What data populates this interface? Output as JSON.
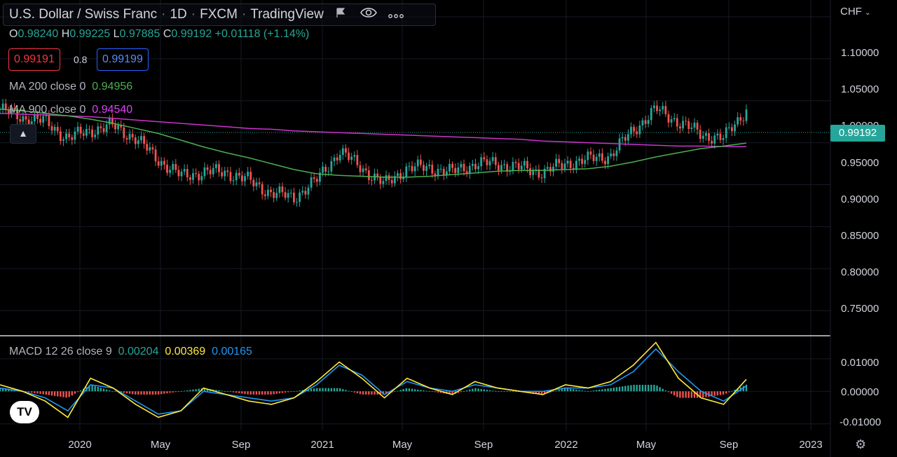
{
  "header": {
    "symbol": "U.S. Dollar / Swiss Franc",
    "interval": "1D",
    "exchange": "FXCM",
    "publisher": "TradingView",
    "separator": "·"
  },
  "ohlc": {
    "o_label": "O",
    "o": "0.98240",
    "h_label": "H",
    "h": "0.99225",
    "l_label": "L",
    "l": "0.97885",
    "c_label": "C",
    "c": "0.99192",
    "change": "+0.01118 (+1.14%)"
  },
  "trade": {
    "sell_price": "0.99191",
    "spread": "0.8",
    "buy_price": "0.99199"
  },
  "indicators": {
    "ma200_label": "MA 200 close 0",
    "ma200_value": "0.94956",
    "ma900_label": "MA 900 close 0",
    "ma900_value": "0.94540"
  },
  "macd": {
    "label": "MACD 12 26 close 9",
    "hist": "0.00204",
    "macd": "0.00369",
    "signal": "0.00165"
  },
  "price_axis": {
    "currency": "CHF",
    "ticks": [
      "1.10000",
      "1.05000",
      "1.00000",
      "0.95000",
      "0.90000",
      "0.85000",
      "0.80000",
      "0.75000"
    ],
    "last_price": "0.99192"
  },
  "macd_axis": {
    "ticks": [
      "0.01000",
      "0.00000",
      "-0.01000"
    ]
  },
  "time_axis": {
    "ticks": [
      "2020",
      "May",
      "Sep",
      "2021",
      "May",
      "Sep",
      "2022",
      "May",
      "Sep",
      "2023"
    ]
  },
  "colors": {
    "up": "#26a69a",
    "down": "#ef5350",
    "ma200": "#4caf50",
    "ma900": "#cc33cc",
    "macd_line": "#ffeb3b",
    "signal_line": "#2196f3"
  },
  "icons": {
    "flag": "flag-icon",
    "eye": "eye-icon",
    "more": "more-icon",
    "collapse": "chevron-up-icon",
    "settings": "gear-icon",
    "logo": "tradingview-logo"
  },
  "chart_data": {
    "type": "line",
    "title": "U.S. Dollar / Swiss Franc · 1D · FXCM",
    "ylabel": "CHF",
    "ylim": [
      0.72,
      1.12
    ],
    "x": [
      "2019-12",
      "2020-01",
      "2020-02",
      "2020-03",
      "2020-04",
      "2020-05",
      "2020-06",
      "2020-07",
      "2020-08",
      "2020-09",
      "2020-10",
      "2020-11",
      "2020-12",
      "2021-01",
      "2021-02",
      "2021-03",
      "2021-04",
      "2021-05",
      "2021-06",
      "2021-07",
      "2021-08",
      "2021-09",
      "2021-10",
      "2021-11",
      "2021-12",
      "2022-01",
      "2022-02",
      "2022-03",
      "2022-04",
      "2022-05",
      "2022-06",
      "2022-07",
      "2022-08",
      "2022-09"
    ],
    "series": [
      {
        "name": "Close",
        "values": [
          0.99,
          0.98,
          0.975,
          0.955,
          0.965,
          0.97,
          0.955,
          0.93,
          0.91,
          0.915,
          0.915,
          0.905,
          0.89,
          0.885,
          0.905,
          0.94,
          0.92,
          0.9,
          0.92,
          0.92,
          0.915,
          0.925,
          0.925,
          0.92,
          0.915,
          0.925,
          0.93,
          0.935,
          0.965,
          0.99,
          0.975,
          0.96,
          0.955,
          0.99
        ]
      },
      {
        "name": "MA 200",
        "values": [
          0.99,
          0.988,
          0.985,
          0.982,
          0.978,
          0.973,
          0.967,
          0.961,
          0.953,
          0.945,
          0.938,
          0.932,
          0.925,
          0.918,
          0.913,
          0.911,
          0.91,
          0.909,
          0.909,
          0.91,
          0.912,
          0.914,
          0.916,
          0.917,
          0.917,
          0.918,
          0.919,
          0.922,
          0.927,
          0.933,
          0.938,
          0.943,
          0.946,
          0.9496
        ]
      },
      {
        "name": "MA 900",
        "values": [
          0.985,
          0.984,
          0.983,
          0.982,
          0.981,
          0.979,
          0.977,
          0.975,
          0.973,
          0.971,
          0.969,
          0.967,
          0.966,
          0.964,
          0.963,
          0.962,
          0.961,
          0.96,
          0.959,
          0.958,
          0.957,
          0.956,
          0.955,
          0.954,
          0.952,
          0.951,
          0.95,
          0.949,
          0.948,
          0.947,
          0.946,
          0.946,
          0.9455,
          0.9454
        ]
      }
    ],
    "macd_panel": {
      "ylim": [
        -0.012,
        0.016
      ],
      "series": [
        {
          "name": "MACD",
          "values": [
            0.002,
            0.0,
            -0.003,
            -0.008,
            0.004,
            0.001,
            -0.004,
            -0.008,
            -0.006,
            0.001,
            -0.001,
            -0.003,
            -0.004,
            -0.002,
            0.003,
            0.009,
            0.004,
            -0.002,
            0.004,
            0.001,
            -0.001,
            0.003,
            0.001,
            0.0,
            -0.001,
            0.002,
            0.001,
            0.003,
            0.008,
            0.015,
            0.004,
            -0.002,
            -0.004,
            0.00369
          ]
        },
        {
          "name": "Signal",
          "values": [
            0.001,
            0.0,
            -0.002,
            -0.006,
            0.002,
            0.001,
            -0.003,
            -0.007,
            -0.006,
            0.0,
            -0.001,
            -0.002,
            -0.003,
            -0.002,
            0.002,
            0.008,
            0.005,
            -0.001,
            0.003,
            0.001,
            0.0,
            0.002,
            0.001,
            0.0,
            0.0,
            0.001,
            0.001,
            0.002,
            0.006,
            0.013,
            0.006,
            0.0,
            -0.003,
            0.00165
          ]
        }
      ]
    }
  }
}
